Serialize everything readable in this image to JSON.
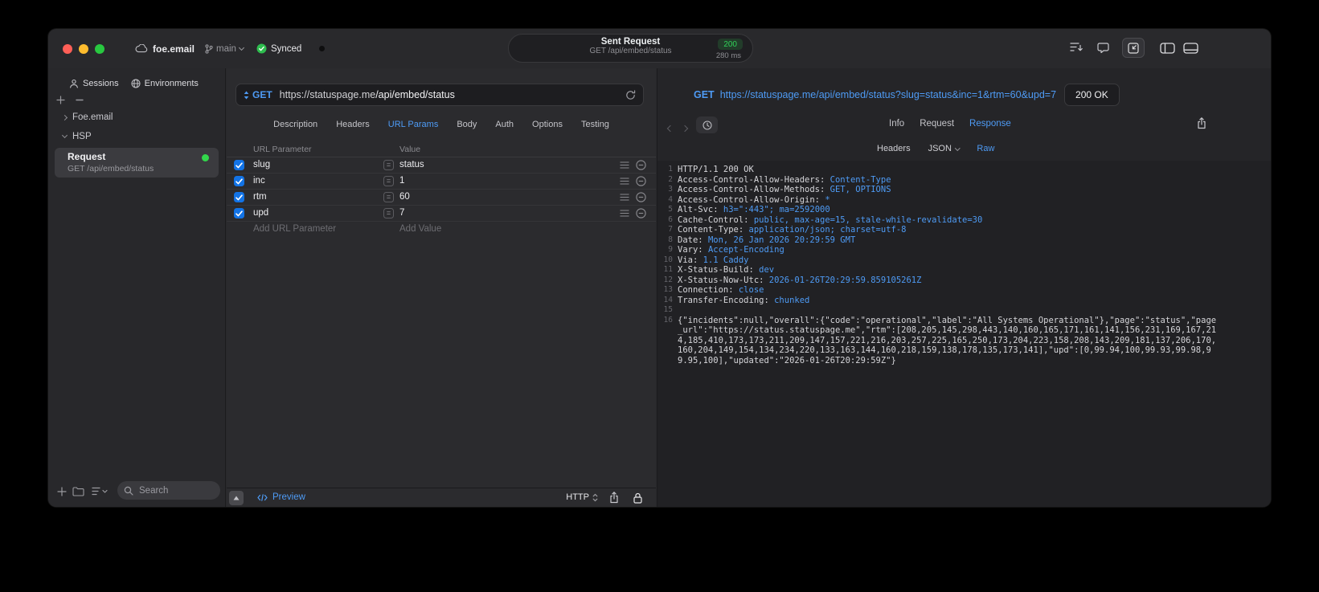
{
  "colors": {
    "accent": "#4e9bf5",
    "green": "#30d158"
  },
  "titlebar": {
    "project": "foe.email",
    "branch": "main",
    "sync": "Synced",
    "request_summary": {
      "title": "Sent Request",
      "status": "200",
      "method_path": "GET /api/embed/status",
      "duration": "280 ms"
    }
  },
  "sidebar": {
    "tabs": [
      {
        "label": "Sessions"
      },
      {
        "label": "Environments"
      }
    ],
    "tree": {
      "group1": "Foe.email",
      "group2": "HSP"
    },
    "request_item": {
      "title": "Request",
      "subtitle": "GET /api/embed/status"
    },
    "search_placeholder": "Search"
  },
  "request_panel": {
    "method": "GET",
    "url_base": "https://statuspage.me",
    "url_path": "/api/embed/status",
    "tabs": [
      "Description",
      "Headers",
      "URL Params",
      "Body",
      "Auth",
      "Options",
      "Testing"
    ],
    "active_tab": "URL Params",
    "param_headers": {
      "name": "URL Parameter",
      "value": "Value"
    },
    "params": [
      {
        "name": "slug",
        "value": "status",
        "enabled": true
      },
      {
        "name": "inc",
        "value": "1",
        "enabled": true
      },
      {
        "name": "rtm",
        "value": "60",
        "enabled": true
      },
      {
        "name": "upd",
        "value": "7",
        "enabled": true
      }
    ],
    "add_param": {
      "name": "Add URL Parameter",
      "value": "Add Value"
    },
    "footer": {
      "preview": "Preview",
      "protocol": "HTTP"
    }
  },
  "response_panel": {
    "method": "GET",
    "url": "https://statuspage.me/api/embed/status?slug=status&inc=1&rtm=60&upd=7",
    "status": "200 OK",
    "tabs": [
      "Info",
      "Request",
      "Response"
    ],
    "active_tab": "Response",
    "subtabs": [
      "Headers",
      "JSON",
      "Raw"
    ],
    "active_subtab": "Raw",
    "raw_lines": [
      {
        "n": "1",
        "parts": [
          {
            "c": "plain",
            "s": "HTTP/1.1 200 OK"
          }
        ]
      },
      {
        "n": "2",
        "parts": [
          {
            "c": "name",
            "s": "Access-Control-Allow-Headers: "
          },
          {
            "c": "val",
            "s": "Content-Type"
          }
        ]
      },
      {
        "n": "3",
        "parts": [
          {
            "c": "name",
            "s": "Access-Control-Allow-Methods: "
          },
          {
            "c": "val",
            "s": "GET, OPTIONS"
          }
        ]
      },
      {
        "n": "4",
        "parts": [
          {
            "c": "name",
            "s": "Access-Control-Allow-Origin: "
          },
          {
            "c": "val",
            "s": "*"
          }
        ]
      },
      {
        "n": "5",
        "parts": [
          {
            "c": "name",
            "s": "Alt-Svc: "
          },
          {
            "c": "val",
            "s": "h3=\":443\"; ma=2592000"
          }
        ]
      },
      {
        "n": "6",
        "parts": [
          {
            "c": "name",
            "s": "Cache-Control: "
          },
          {
            "c": "val",
            "s": "public, max-age=15, stale-while-revalidate=30"
          }
        ]
      },
      {
        "n": "7",
        "parts": [
          {
            "c": "name",
            "s": "Content-Type: "
          },
          {
            "c": "val",
            "s": "application/json; charset=utf-8"
          }
        ]
      },
      {
        "n": "8",
        "parts": [
          {
            "c": "name",
            "s": "Date: "
          },
          {
            "c": "val",
            "s": "Mon, 26 Jan 2026 20:29:59 GMT"
          }
        ]
      },
      {
        "n": "9",
        "parts": [
          {
            "c": "name",
            "s": "Vary: "
          },
          {
            "c": "val",
            "s": "Accept-Encoding"
          }
        ]
      },
      {
        "n": "10",
        "parts": [
          {
            "c": "name",
            "s": "Via: "
          },
          {
            "c": "val",
            "s": "1.1 Caddy"
          }
        ]
      },
      {
        "n": "11",
        "parts": [
          {
            "c": "name",
            "s": "X-Status-Build: "
          },
          {
            "c": "val",
            "s": "dev"
          }
        ]
      },
      {
        "n": "12",
        "parts": [
          {
            "c": "name",
            "s": "X-Status-Now-Utc: "
          },
          {
            "c": "val",
            "s": "2026-01-26T20:29:59.859105261Z"
          }
        ]
      },
      {
        "n": "13",
        "parts": [
          {
            "c": "name",
            "s": "Connection: "
          },
          {
            "c": "val",
            "s": "close"
          }
        ]
      },
      {
        "n": "14",
        "parts": [
          {
            "c": "name",
            "s": "Transfer-Encoding: "
          },
          {
            "c": "val",
            "s": "chunked"
          }
        ]
      },
      {
        "n": "15",
        "parts": []
      },
      {
        "n": "16",
        "parts": [
          {
            "c": "plain",
            "s": "{\"incidents\":null,\"overall\":{\"code\":\"operational\",\"label\":\"All Systems Operational\"},\"page\":\"status\",\"page_url\":\"https://status.statuspage.me\",\"rtm\":[208,205,145,298,443,140,160,165,171,161,141,156,231,169,167,214,185,410,173,173,211,209,147,157,221,216,203,257,225,165,250,173,204,223,158,208,143,209,181,137,206,170,160,204,149,154,134,234,220,133,163,144,160,218,159,138,178,135,173,141],\"upd\":[0,99.94,100,99.93,99.98,99.95,100],\"updated\":\"2026-01-26T20:29:59Z\"}"
          }
        ]
      }
    ]
  }
}
